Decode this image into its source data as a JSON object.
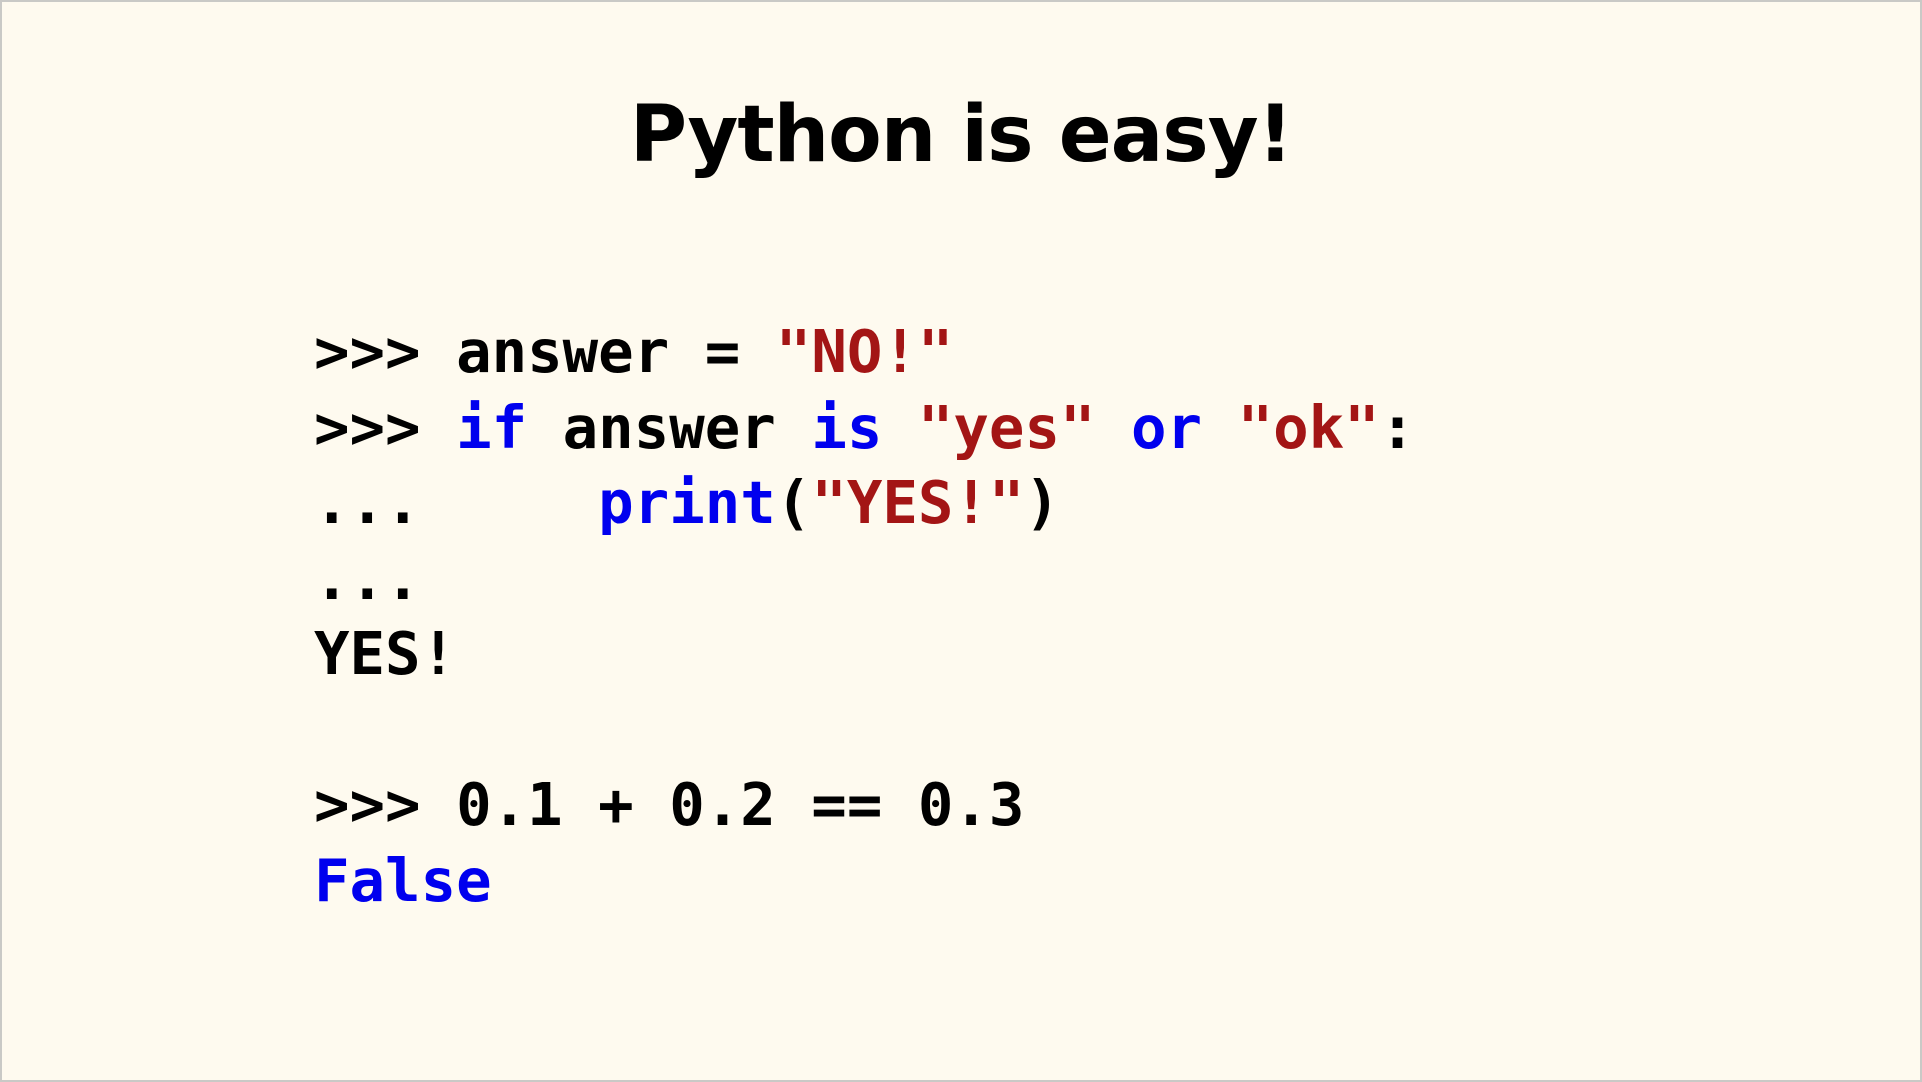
{
  "slide": {
    "title": "Python is easy!",
    "colors": {
      "background": "#fefaef",
      "text": "#000000",
      "keyword": "#0000ee",
      "string": "#a31515"
    },
    "code_lines": [
      {
        "tokens": [
          {
            "text": ">>> ",
            "type": "prompt"
          },
          {
            "text": "answer = ",
            "type": "plain"
          },
          {
            "text": "\"NO!\"",
            "type": "string"
          }
        ]
      },
      {
        "tokens": [
          {
            "text": ">>> ",
            "type": "prompt"
          },
          {
            "text": "if",
            "type": "keyword"
          },
          {
            "text": " answer ",
            "type": "plain"
          },
          {
            "text": "is",
            "type": "keyword"
          },
          {
            "text": " ",
            "type": "plain"
          },
          {
            "text": "\"yes\"",
            "type": "string"
          },
          {
            "text": " ",
            "type": "plain"
          },
          {
            "text": "or",
            "type": "keyword"
          },
          {
            "text": " ",
            "type": "plain"
          },
          {
            "text": "\"ok\"",
            "type": "string"
          },
          {
            "text": ":",
            "type": "plain"
          }
        ]
      },
      {
        "tokens": [
          {
            "text": "...     ",
            "type": "prompt"
          },
          {
            "text": "print",
            "type": "keyword"
          },
          {
            "text": "(",
            "type": "plain"
          },
          {
            "text": "\"YES!\"",
            "type": "string"
          },
          {
            "text": ")",
            "type": "plain"
          }
        ]
      },
      {
        "tokens": [
          {
            "text": "...",
            "type": "prompt"
          }
        ]
      },
      {
        "tokens": [
          {
            "text": "YES!",
            "type": "output"
          }
        ]
      },
      {
        "blank": true,
        "tokens": []
      },
      {
        "tokens": [
          {
            "text": ">>> ",
            "type": "prompt"
          },
          {
            "text": "0.1 + 0.2 == 0.3",
            "type": "plain"
          }
        ]
      },
      {
        "tokens": [
          {
            "text": "False",
            "type": "keyword"
          }
        ]
      }
    ]
  }
}
